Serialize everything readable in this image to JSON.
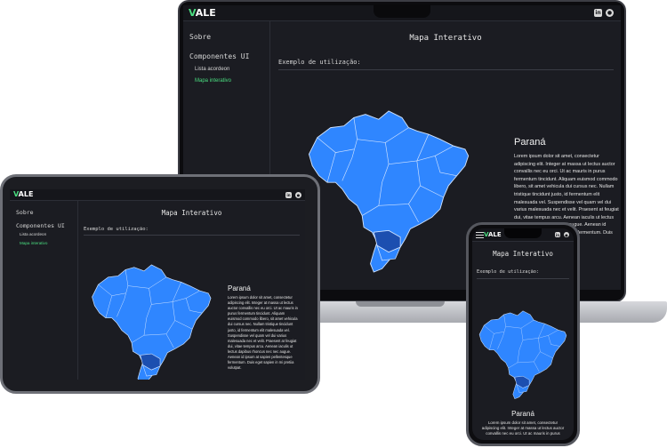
{
  "app": {
    "logo_mark": "V",
    "logo_text": "ALE",
    "page_title": "Mapa Interativo",
    "section_label": "Exemplo de utilização:",
    "sidebar": {
      "about": "Sobre",
      "components": "Componentes UI",
      "items": [
        "Lista acordeon",
        "Mapa interativo"
      ]
    },
    "social_icons": [
      "linkedin-icon",
      "github-icon"
    ],
    "selected_state": {
      "name": "Paraná",
      "description_laptop": "Lorem ipsum dolor sit amet, consectetur adipiscing elit. Integer at massa ut lectus auctor convallis nec eu orci. Ut ac mauris in purus fermentum tincidunt. Aliquam euismod commodo libero, sit amet vehicula dui cursus nec. Nullam tristique tincidunt justo, id fermentum elit malesuada vel. Suspendisse vel quam vel dui varius malesuada nec et velit. Praesent at feugiat dui, vitae tempus arcu. Aenean iaculis ut lectus dapibus rhoncus nec nec augue. Aenean id ipsum at sapien pellentesque fermentum. Duis eget",
      "description_tablet": "Lorem ipsum dolor sit amet, consectetur adipiscing elit. Integer at massa ut lectus auctor convallis nec eu orci. Ut ac mauris in purus fermentum tincidunt. Aliquam euismod commodo libero, sit amet vehicula dui cursus nec. Nullam tristique tincidunt justo, id fermentum elit malesuada vel. Suspendisse vel quam vel dui varius malesuada nec et velit. Praesent at feugiat dui, vitae tempus arcu. Aenean iaculis ut lectus dapibus rhoncus nec nec augue. Aenean id ipsum at sapien pellentesque fermentum. Duis eget sapien in mi pretiia volutpat.",
      "description_phone": "Lorem ipsum dolor sit amet, consectetur adipiscing elit. Integer at massa ut lectus auctor convallis nec eu orci. Ut ac mauris in purus"
    },
    "colors": {
      "map_fill": "#2f86ff",
      "map_selected": "#1c4fb0",
      "map_border": "#cfe2ff",
      "accent": "#4ade80",
      "background": "#1b1c22"
    }
  }
}
